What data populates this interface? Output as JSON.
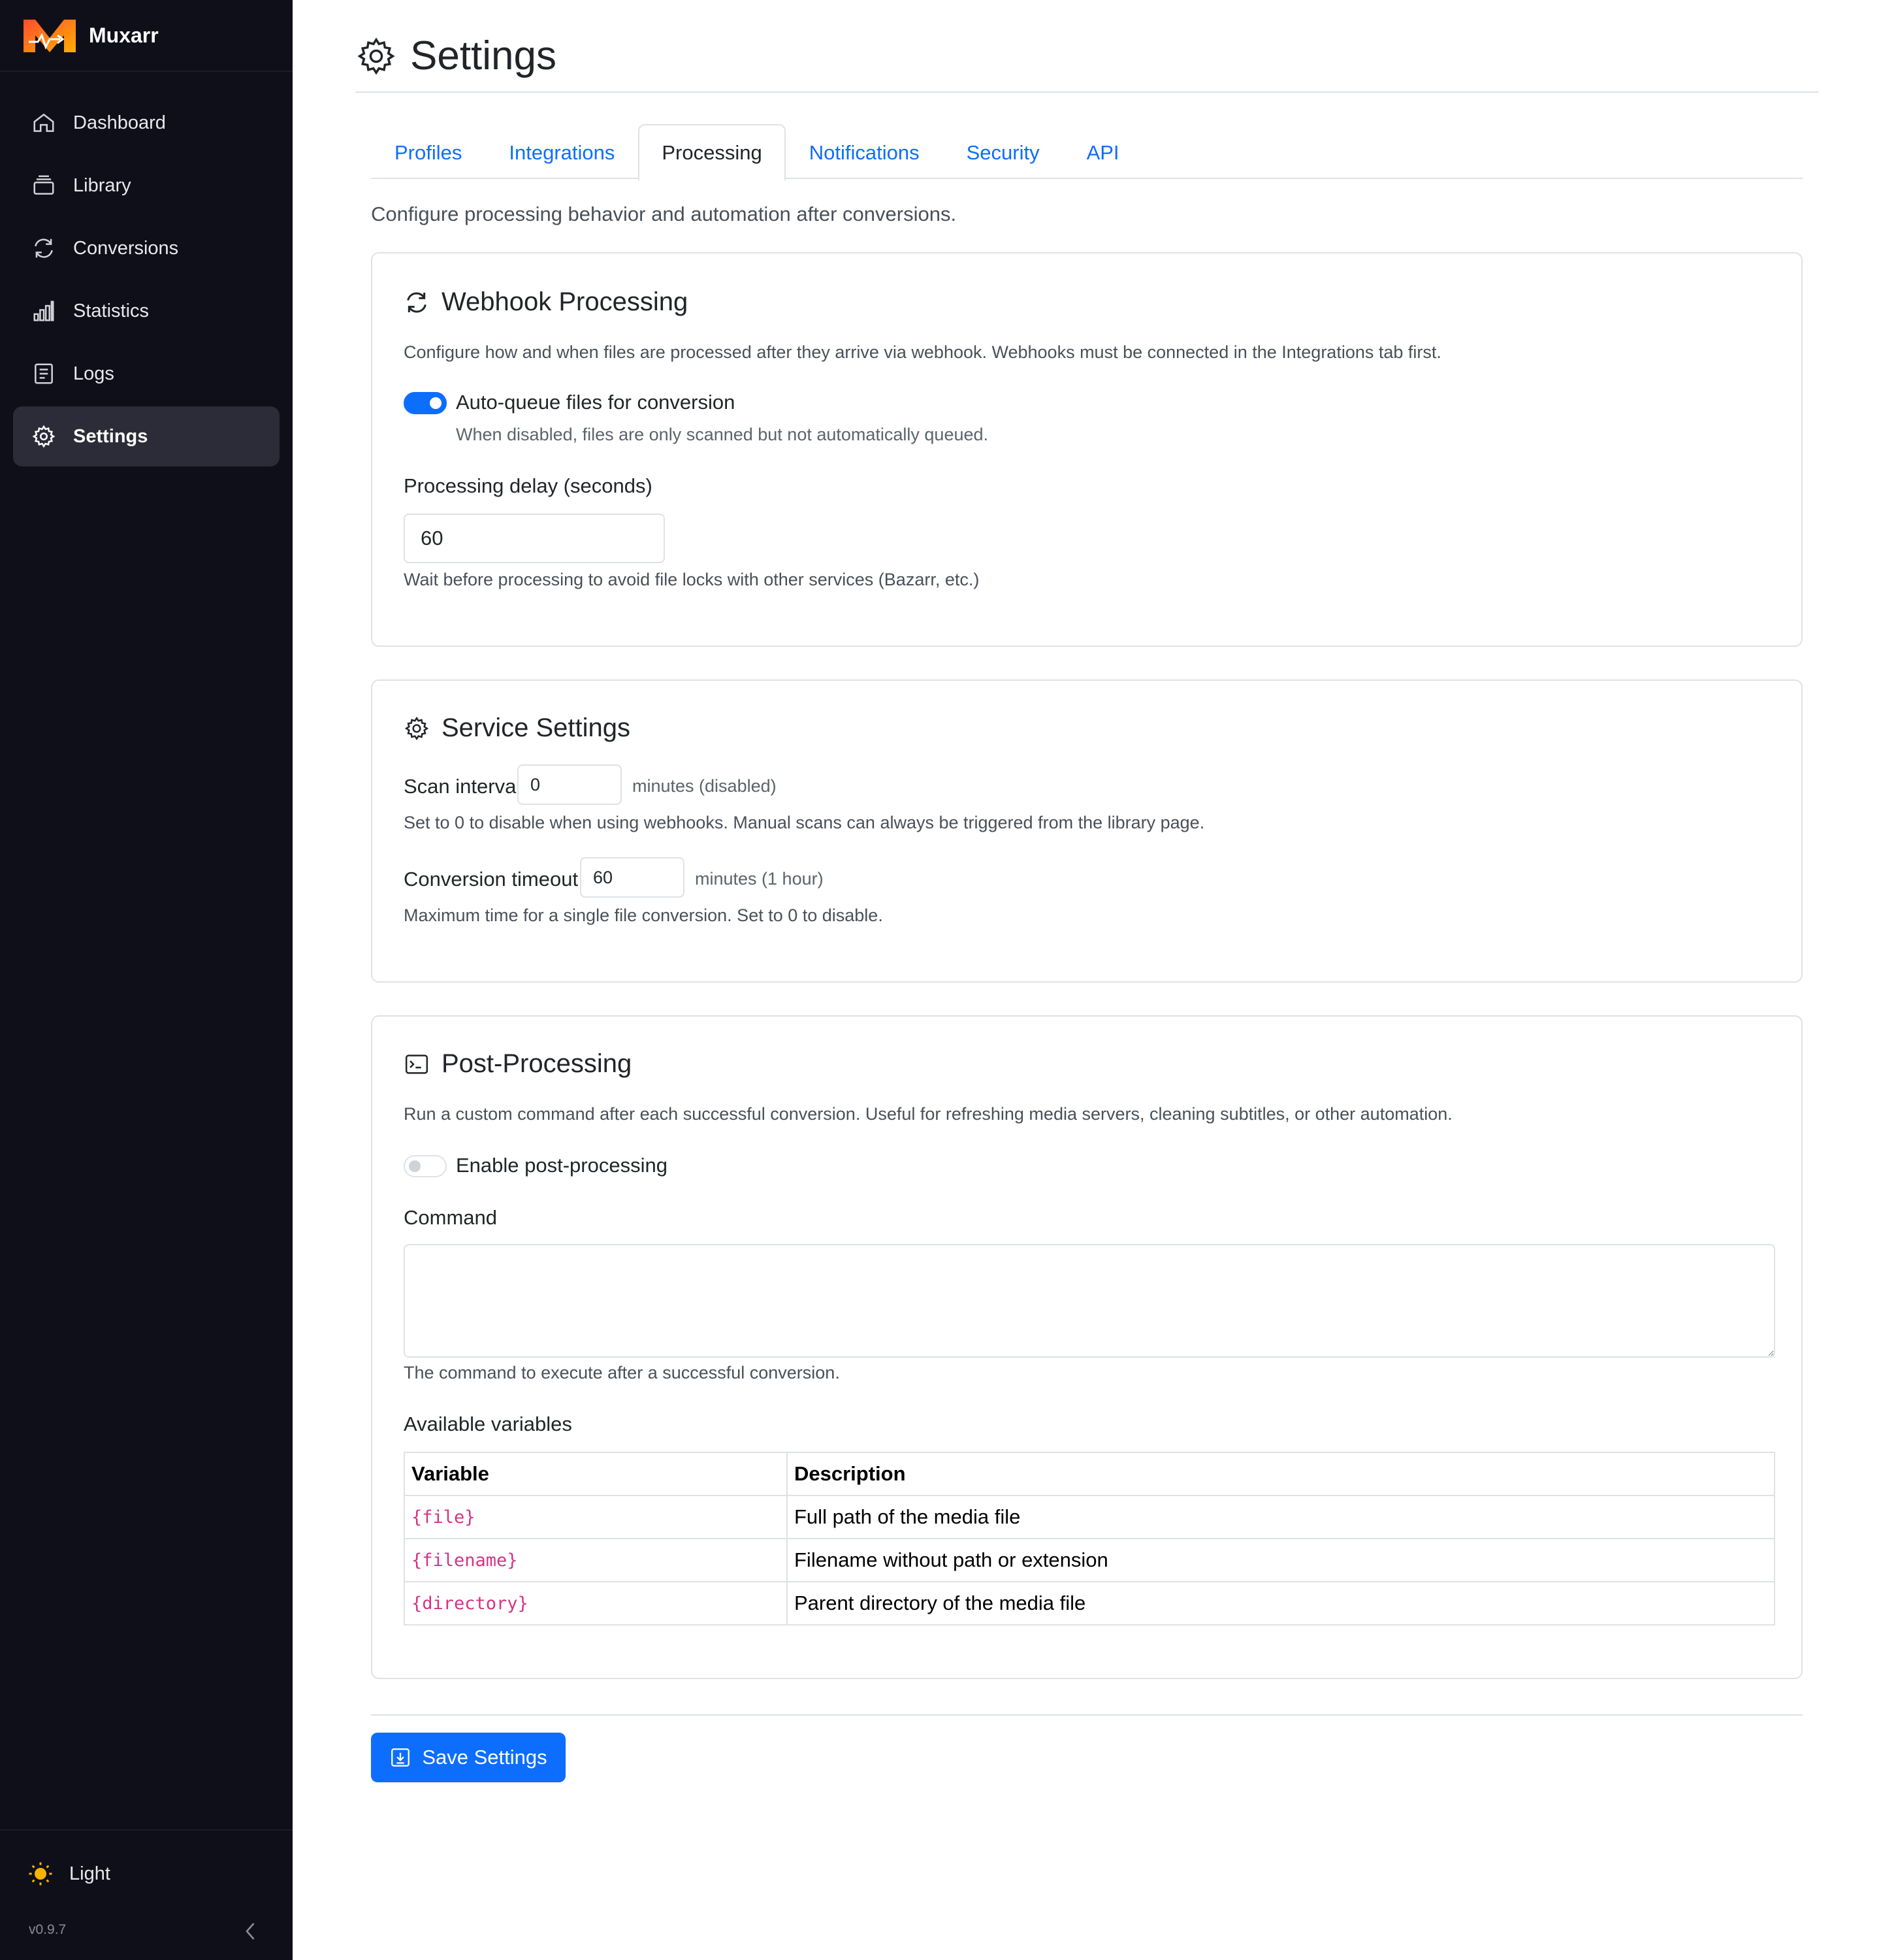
{
  "app": {
    "name": "Muxarr",
    "version": "v0.9.7"
  },
  "sidebar": {
    "items": [
      {
        "label": "Dashboard",
        "icon": "home-icon"
      },
      {
        "label": "Library",
        "icon": "library-icon"
      },
      {
        "label": "Conversions",
        "icon": "refresh-icon"
      },
      {
        "label": "Statistics",
        "icon": "bar-chart-icon"
      },
      {
        "label": "Logs",
        "icon": "logs-icon"
      },
      {
        "label": "Settings",
        "icon": "gear-icon",
        "active": true
      }
    ],
    "theme_label": "Light"
  },
  "page": {
    "title": "Settings"
  },
  "tabs": [
    "Profiles",
    "Integrations",
    "Processing",
    "Notifications",
    "Security",
    "API"
  ],
  "active_tab": "Processing",
  "tab_description": "Configure processing behavior and automation after conversions.",
  "webhook": {
    "title": "Webhook Processing",
    "description": "Configure how and when files are processed after they arrive via webhook. Webhooks must be connected in the Integrations tab first.",
    "auto_queue_label": "Auto-queue files for conversion",
    "auto_queue_enabled": true,
    "auto_queue_help": "When disabled, files are only scanned but not automatically queued.",
    "delay_label": "Processing delay (seconds)",
    "delay_value": "60",
    "delay_help": "Wait before processing to avoid file locks with other services (Bazarr, etc.)"
  },
  "service": {
    "title": "Service Settings",
    "scan_label": "Scan interval",
    "scan_value": "0",
    "scan_unit": "minutes (disabled)",
    "scan_help": "Set to 0 to disable when using webhooks. Manual scans can always be triggered from the library page.",
    "timeout_label": "Conversion timeout",
    "timeout_value": "60",
    "timeout_unit": "minutes (1 hour)",
    "timeout_help": "Maximum time for a single file conversion. Set to 0 to disable."
  },
  "post": {
    "title": "Post-Processing",
    "description": "Run a custom command after each successful conversion. Useful for refreshing media servers, cleaning subtitles, or other automation.",
    "enable_label": "Enable post-processing",
    "enabled": false,
    "command_label": "Command",
    "command_value": "",
    "command_help": "The command to execute after a successful conversion.",
    "vars_label": "Available variables",
    "table": {
      "headers": [
        "Variable",
        "Description"
      ],
      "rows": [
        [
          "{file}",
          "Full path of the media file"
        ],
        [
          "{filename}",
          "Filename without path or extension"
        ],
        [
          "{directory}",
          "Parent directory of the media file"
        ]
      ]
    }
  },
  "save_label": "Save Settings",
  "colors": {
    "accent": "#0d6efd",
    "sidebar_bg": "#0f0f1a",
    "code": "#d63384"
  }
}
